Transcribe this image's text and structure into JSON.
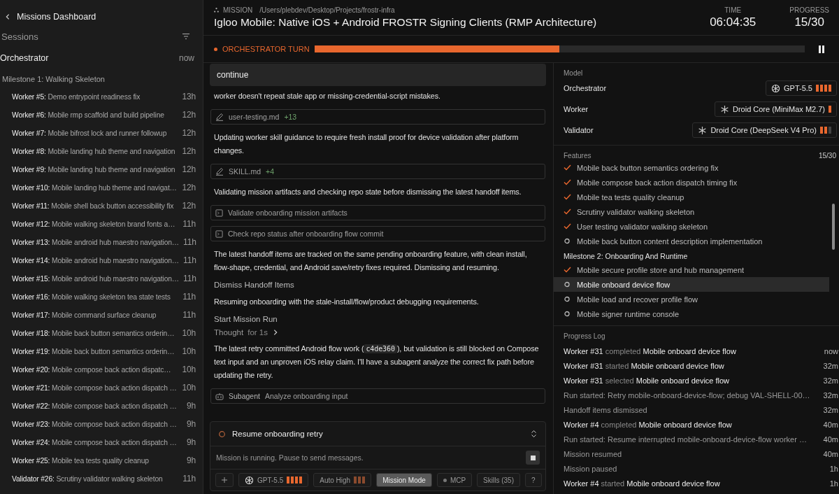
{
  "sidebar": {
    "back_label": "Missions Dashboard",
    "sessions_heading": "Sessions",
    "orchestrator": {
      "label": "Orchestrator",
      "time": "now"
    },
    "milestone": "Milestone 1: Walking Skeleton",
    "sessions": [
      {
        "label": "Worker #5:",
        "title": "Demo entrypoint readiness fix",
        "time": "13h"
      },
      {
        "label": "Worker #6:",
        "title": "Mobile rmp scaffold and build pipeline",
        "time": "12h"
      },
      {
        "label": "Worker #7:",
        "title": "Mobile bifrost lock and runner followup",
        "time": "12h"
      },
      {
        "label": "Worker #8:",
        "title": "Mobile landing hub theme and navigation",
        "time": "12h"
      },
      {
        "label": "Worker #9:",
        "title": "Mobile landing hub theme and navigation",
        "time": "12h"
      },
      {
        "label": "Worker #10:",
        "title": "Mobile landing hub theme and navigat…",
        "time": "12h"
      },
      {
        "label": "Worker #11:",
        "title": "Mobile shell back button accessibility fix",
        "time": "12h"
      },
      {
        "label": "Worker #12:",
        "title": "Mobile walking skeleton brand fonts a…",
        "time": "11h"
      },
      {
        "label": "Worker #13:",
        "title": "Mobile android hub maestro navigation…",
        "time": "11h"
      },
      {
        "label": "Worker #14:",
        "title": "Mobile android hub maestro navigation…",
        "time": "11h"
      },
      {
        "label": "Worker #15:",
        "title": "Mobile android hub maestro navigation…",
        "time": "11h"
      },
      {
        "label": "Worker #16:",
        "title": "Mobile walking skeleton tea state tests",
        "time": "11h"
      },
      {
        "label": "Worker #17:",
        "title": "Mobile command surface cleanup",
        "time": "11h"
      },
      {
        "label": "Worker #18:",
        "title": "Mobile back button semantics orderin…",
        "time": "10h"
      },
      {
        "label": "Worker #19:",
        "title": "Mobile back button semantics orderin…",
        "time": "10h"
      },
      {
        "label": "Worker #20:",
        "title": "Mobile compose back action dispatc…",
        "time": "10h"
      },
      {
        "label": "Worker #21:",
        "title": "Mobile compose back action dispatch …",
        "time": "10h"
      },
      {
        "label": "Worker #22:",
        "title": "Mobile compose back action dispatch …",
        "time": "9h"
      },
      {
        "label": "Worker #23:",
        "title": "Mobile compose back action dispatch …",
        "time": "9h"
      },
      {
        "label": "Worker #24:",
        "title": "Mobile compose back action dispatch …",
        "time": "9h"
      },
      {
        "label": "Worker #25:",
        "title": "Mobile tea tests quality cleanup",
        "time": "9h"
      },
      {
        "label": "Validator #26:",
        "title": "Scrutiny validator walking skeleton",
        "time": "11h"
      }
    ]
  },
  "header": {
    "tag": "MISSION",
    "path": "/Users/plebdev/Desktop/Projects/frostr-infra",
    "title": "Igloo Mobile: Native iOS + Android FROSTR Signing Clients (RMP Architecture)",
    "time_label": "TIME",
    "time": "06:04:35",
    "progress_label": "PROGRESS",
    "progress": "15/30"
  },
  "turn": {
    "label": "ORCHESTRATOR TURN",
    "level": 0.5
  },
  "conversation": {
    "user_message": "continue",
    "items": [
      {
        "kind": "text",
        "text": "worker doesn't repeat stale app or missing-credential-script mistakes."
      },
      {
        "kind": "file",
        "name": "user-testing.md",
        "added": "+13"
      },
      {
        "kind": "text",
        "text": "Updating worker skill guidance to require fresh install proof for device validation after platform changes."
      },
      {
        "kind": "file",
        "name": "SKILL.md",
        "added": "+4"
      },
      {
        "kind": "text",
        "text": "Validating mission artifacts and checking repo state before dismissing the latest handoff items."
      },
      {
        "kind": "command",
        "name": "Validate onboarding mission artifacts"
      },
      {
        "kind": "command",
        "name": "Check repo status after onboarding flow commit"
      },
      {
        "kind": "text",
        "text": "The latest handoff items are tracked on the same pending onboarding feature, with clean install, flow-shape, credential, and Android save/retry fixes required. Dismissing and resuming."
      },
      {
        "kind": "action",
        "text": "Dismiss Handoff Items"
      },
      {
        "kind": "text",
        "text": "Resuming onboarding with the stale-install/flow/product debugging requirements."
      },
      {
        "kind": "action",
        "text": "Start Mission Run"
      },
      {
        "kind": "thought",
        "label": "Thought",
        "detail": "for 1s"
      },
      {
        "kind": "code_text",
        "before": "The latest retry committed Android flow work (",
        "code": "c4de360",
        "after": "), but validation is still blocked on Compose text input and an unproven iOS relay claim. I'll have a subagent analyze the correct fix path before updating the retry."
      },
      {
        "kind": "subagent",
        "label": "Subagent",
        "task": "Analyze onboarding input"
      }
    ]
  },
  "composer": {
    "task": "Resume onboarding retry",
    "status": "Mission is running. Pause to send messages.",
    "chips": [
      {
        "kind": "model",
        "label": "GPT-5.5",
        "bars": [
          {
            "on": true
          },
          {
            "on": true
          },
          {
            "on": true
          },
          {
            "on": true
          }
        ]
      },
      {
        "kind": "effort",
        "label": "Auto High",
        "bars": [
          {
            "on": true
          },
          {
            "on": true
          },
          {
            "on": true
          }
        ]
      },
      {
        "kind": "mode",
        "label": "Mission Mode",
        "selected": true
      },
      {
        "kind": "mcp",
        "label": "MCP"
      },
      {
        "kind": "plain",
        "label": "Skills (35)"
      },
      {
        "kind": "plain",
        "label": "?"
      }
    ]
  },
  "models": {
    "heading": "Model",
    "rows": [
      {
        "role": "Orchestrator",
        "model": "GPT-5.5",
        "bars": [
          {
            "on": true
          },
          {
            "on": true
          },
          {
            "on": true
          },
          {
            "on": true
          }
        ]
      },
      {
        "role": "Worker",
        "model": "Droid Core (MiniMax M2.7)",
        "bars": [
          {
            "on": true
          }
        ]
      },
      {
        "role": "Validator",
        "model": "Droid Core (DeepSeek V4 Pro)",
        "bars": [
          {
            "on": true
          },
          {
            "on": true
          },
          {
            "on": false
          }
        ]
      }
    ]
  },
  "features": {
    "heading": "Features",
    "count": "15/30",
    "groups": [
      {
        "items": [
          {
            "label": "Mobile back button semantics ordering fix",
            "done": true,
            "selected": false
          },
          {
            "label": "Mobile compose back action dispatch timing fix",
            "done": true,
            "selected": false
          },
          {
            "label": "Mobile tea tests quality cleanup",
            "done": true,
            "selected": false
          },
          {
            "label": "Scrutiny validator walking skeleton",
            "done": true,
            "selected": false
          },
          {
            "label": "User testing validator walking skeleton",
            "done": true,
            "selected": false
          },
          {
            "label": "Mobile back button content description implementation",
            "done": false,
            "selected": false
          }
        ]
      },
      {
        "title": "Milestone 2: Onboarding And Runtime",
        "items": [
          {
            "label": "Mobile secure profile store and hub management",
            "done": true,
            "selected": false
          },
          {
            "label": "Mobile onboard device flow",
            "done": false,
            "selected": true
          },
          {
            "label": "Mobile load and recover profile flow",
            "done": false,
            "selected": false
          },
          {
            "label": "Mobile signer runtime console",
            "done": false,
            "selected": false
          }
        ]
      }
    ]
  },
  "progress_log": {
    "heading": "Progress Log",
    "entries": [
      {
        "kind": "worker",
        "actor": "Worker #31",
        "verb": "completed",
        "target": "Mobile onboard device flow",
        "time": "now"
      },
      {
        "kind": "worker",
        "actor": "Worker #31",
        "verb": "started",
        "target": "Mobile onboard device flow",
        "time": "32m"
      },
      {
        "kind": "worker",
        "actor": "Worker #31",
        "verb": "selected",
        "target": "Mobile onboard device flow",
        "time": "32m"
      },
      {
        "kind": "system",
        "text": "Run started: Retry mobile-onboard-device-flow; debug VAL-SHELL-00…",
        "time": "32m"
      },
      {
        "kind": "system",
        "text": "Handoff items dismissed",
        "time": "32m"
      },
      {
        "kind": "worker",
        "actor": "Worker #4",
        "verb": "completed",
        "target": "Mobile onboard device flow",
        "time": "40m"
      },
      {
        "kind": "system",
        "text": "Run started: Resume interrupted mobile-onboard-device-flow worker …",
        "time": "40m"
      },
      {
        "kind": "system",
        "text": "Mission resumed",
        "time": "40m"
      },
      {
        "kind": "system",
        "text": "Mission paused",
        "time": "1h"
      },
      {
        "kind": "worker",
        "actor": "Worker #4",
        "verb": "started",
        "target": "Mobile onboard device flow",
        "time": "1h"
      }
    ]
  }
}
